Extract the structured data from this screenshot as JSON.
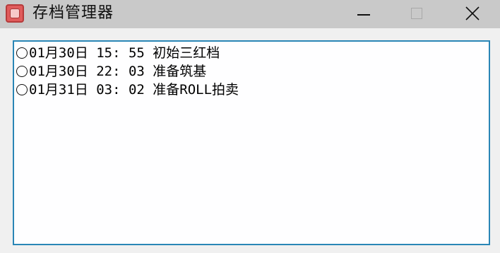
{
  "window": {
    "title": "存档管理器",
    "icon": "app-icon",
    "controls": [
      "minimize-icon",
      "maximize-icon",
      "close-icon"
    ]
  },
  "saves": [
    {
      "label": "01月30日 15: 55 初始三红档",
      "selected": false
    },
    {
      "label": "01月30日 22: 03 准备筑基",
      "selected": false
    },
    {
      "label": "01月31日 03: 02 准备ROLL拍卖",
      "selected": false
    }
  ],
  "colors": {
    "titlebar": "#c9c9c9",
    "window": "#f0f0f0",
    "list_border": "#2a86b6",
    "list_bg": "#fefeff"
  }
}
